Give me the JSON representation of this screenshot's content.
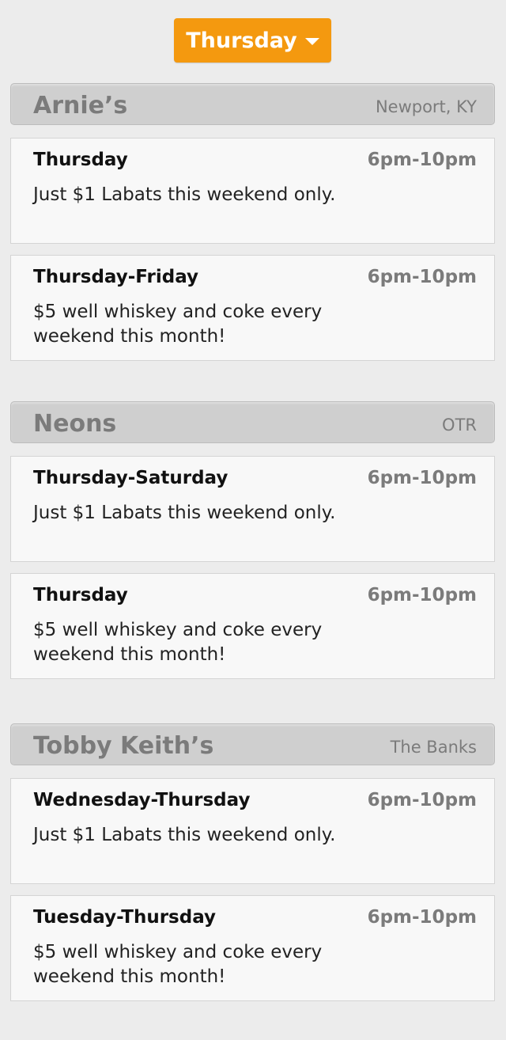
{
  "filter": {
    "selected_day": "Thursday",
    "caret_icon": "caret-down-icon"
  },
  "venues": [
    {
      "name": "Arnie’s",
      "location": "Newport, KY",
      "specials": [
        {
          "days": "Thursday",
          "time": "6pm-10pm",
          "description": "Just $1 Labats this weekend only."
        },
        {
          "days": "Thursday-Friday",
          "time": "6pm-10pm",
          "description": "$5 well whiskey and coke every weekend this month!"
        }
      ]
    },
    {
      "name": "Neons",
      "location": "OTR",
      "specials": [
        {
          "days": "Thursday-Saturday",
          "time": "6pm-10pm",
          "description": "Just $1 Labats this weekend only."
        },
        {
          "days": "Thursday",
          "time": "6pm-10pm",
          "description": "$5 well whiskey and coke every weekend this month!"
        }
      ]
    },
    {
      "name": "Tobby Keith’s",
      "location": "The Banks",
      "specials": [
        {
          "days": "Wednesday-Thursday",
          "time": "6pm-10pm",
          "description": "Just $1 Labats this weekend only."
        },
        {
          "days": "Tuesday-Thursday",
          "time": "6pm-10pm",
          "description": "$5 well whiskey and coke every weekend this month!"
        }
      ]
    }
  ],
  "colors": {
    "accent": "#f4990f",
    "header_bg": "#cfcfcf",
    "card_bg": "#f8f8f8",
    "page_bg": "#ececec",
    "muted_text": "#7b7b7b"
  }
}
